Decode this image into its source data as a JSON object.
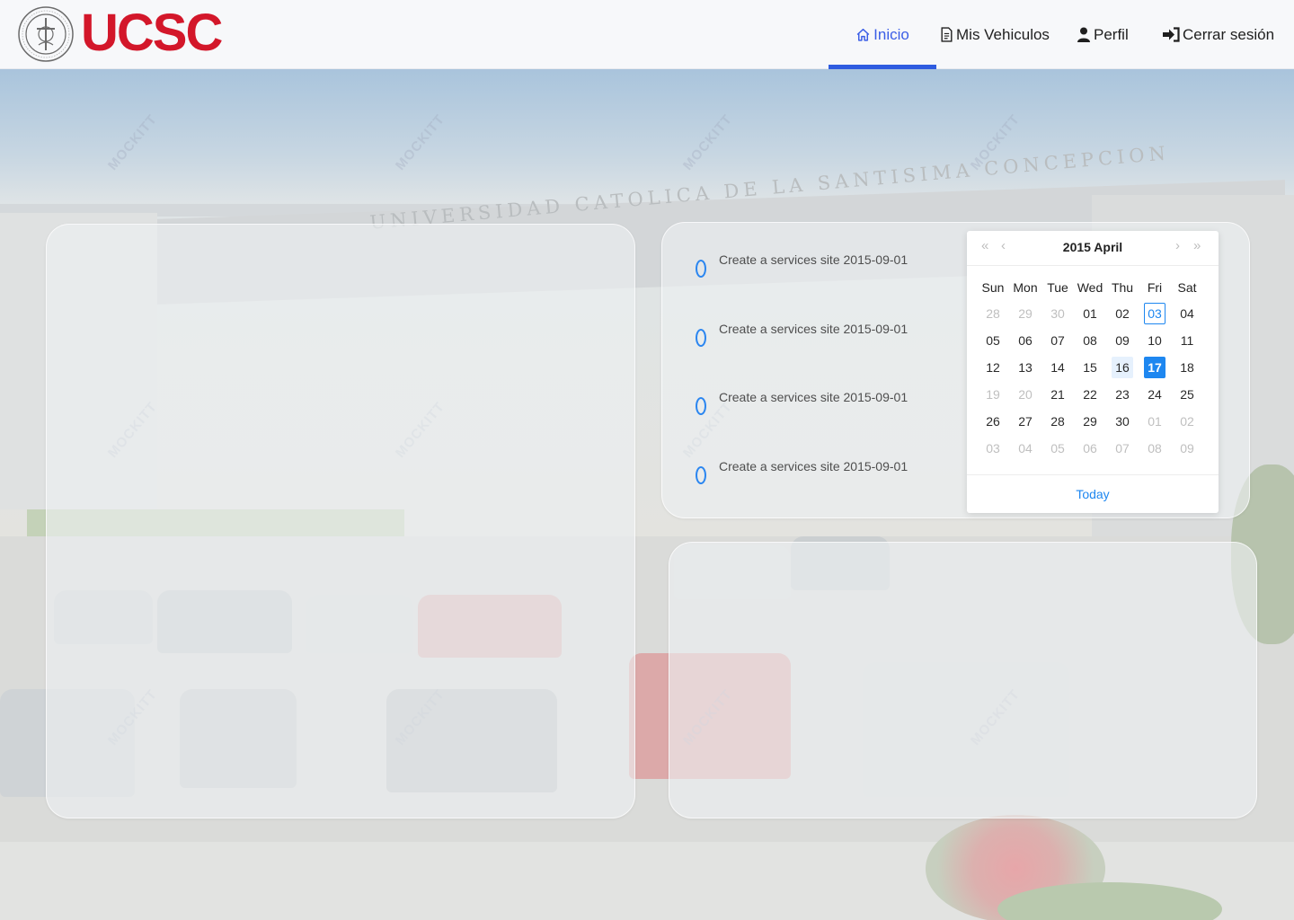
{
  "header": {
    "logo_text": "UCSC",
    "seal_icon": "university-seal-icon",
    "nav": {
      "inicio": {
        "label": "Inicio",
        "icon": "home-icon"
      },
      "vehiculos": {
        "label": "Mis Vehiculos",
        "icon": "document-icon"
      },
      "perfil": {
        "label": "Perfil",
        "icon": "user-icon"
      },
      "logout": {
        "label": "Cerrar sesión",
        "icon": "sign-out-icon"
      }
    },
    "active_tab": "Inicio"
  },
  "background": {
    "facade_text": "UNIVERSIDAD CATOLICA DE LA SANTISIMA CONCEPCION",
    "watermark": "MOCKITT"
  },
  "timeline": {
    "items": [
      {
        "text": "Create a services site 2015-09-01"
      },
      {
        "text": "Create a services site 2015-09-01"
      },
      {
        "text": "Create a services site 2015-09-01"
      },
      {
        "text": "Create a services site 2015-09-01"
      }
    ]
  },
  "calendar": {
    "title": "2015 April",
    "prev_year": "«",
    "prev_month": "‹",
    "next_month": "›",
    "next_year": "»",
    "weekdays": [
      "Sun",
      "Mon",
      "Tue",
      "Wed",
      "Thu",
      "Fri",
      "Sat"
    ],
    "weeks": [
      [
        "28",
        "29",
        "30",
        "01",
        "02",
        "03",
        "04"
      ],
      [
        "05",
        "06",
        "07",
        "08",
        "09",
        "10",
        "11"
      ],
      [
        "12",
        "13",
        "14",
        "15",
        "16",
        "17",
        "18"
      ],
      [
        "19",
        "20",
        "21",
        "22",
        "23",
        "24",
        "25"
      ],
      [
        "26",
        "27",
        "28",
        "29",
        "30",
        "01",
        "02"
      ],
      [
        "03",
        "04",
        "05",
        "06",
        "07",
        "08",
        "09"
      ]
    ],
    "today_label": "Today",
    "selected_day": "17",
    "current_day": "03",
    "accent_color": "#1e87f0"
  },
  "colors": {
    "brand": "#d3172a",
    "nav_active": "#3b5ee6"
  }
}
